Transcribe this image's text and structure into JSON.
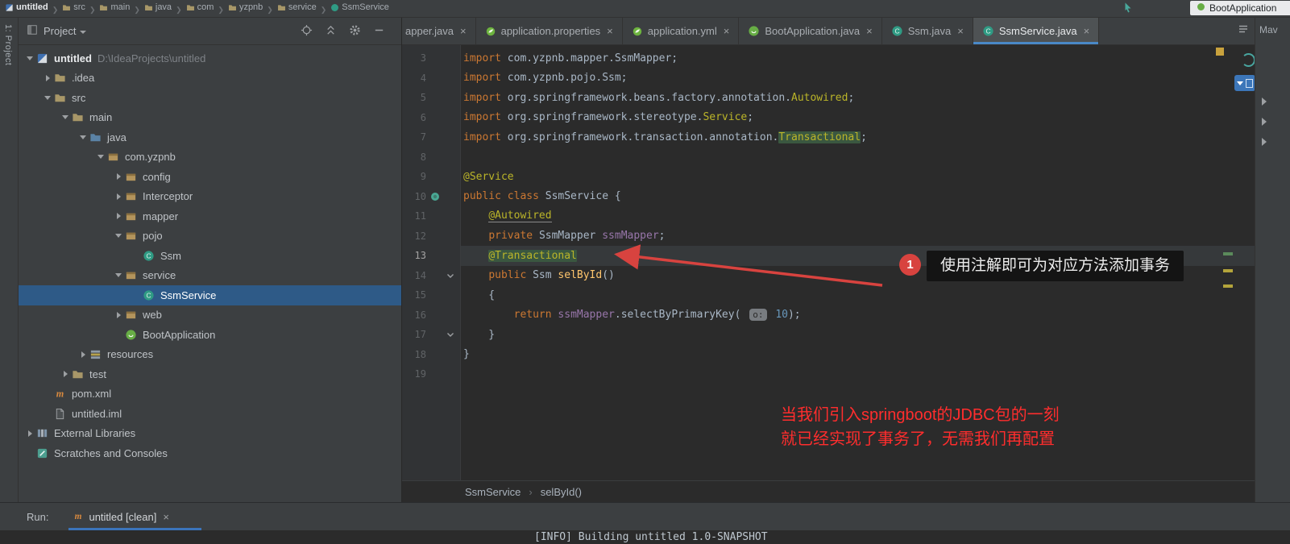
{
  "ui": {
    "crumb_sep": "❯",
    "breadcrumb_sep": "›",
    "close_glyph": "×"
  },
  "colors": {
    "selection_blue": "#2E5A87",
    "active_tab_underline": "#4A88C7",
    "annotation_red": "#D8433F",
    "note_red": "#FF2D2D",
    "keyword_orange": "#CC7832",
    "annotation_yellow": "#BBB529",
    "identifier_highlight_green": "#3A5740"
  },
  "window": {
    "breadcrumbs": [
      "untitled",
      "src",
      "main",
      "java",
      "com",
      "yzpnb",
      "service",
      "SsmService"
    ],
    "run_config_label": "BootApplication"
  },
  "left_stripe": {
    "label": "1: Project"
  },
  "project_panel": {
    "title": "Project",
    "tree": [
      {
        "label": "untitled",
        "hint": "D:\\IdeaProjects\\untitled",
        "level": 0,
        "arrow": "down",
        "icon": "project",
        "bold": true
      },
      {
        "label": ".idea",
        "level": 1,
        "arrow": "right",
        "icon": "folder"
      },
      {
        "label": "src",
        "level": 1,
        "arrow": "down",
        "icon": "folder"
      },
      {
        "label": "main",
        "level": 2,
        "arrow": "down",
        "icon": "folder"
      },
      {
        "label": "java",
        "level": 3,
        "arrow": "down",
        "icon": "folder-src"
      },
      {
        "label": "com.yzpnb",
        "level": 4,
        "arrow": "down",
        "icon": "package"
      },
      {
        "label": "config",
        "level": 5,
        "arrow": "right",
        "icon": "package"
      },
      {
        "label": "Interceptor",
        "level": 5,
        "arrow": "right",
        "icon": "package"
      },
      {
        "label": "mapper",
        "level": 5,
        "arrow": "right",
        "icon": "package"
      },
      {
        "label": "pojo",
        "level": 5,
        "arrow": "down",
        "icon": "package"
      },
      {
        "label": "Ssm",
        "level": 6,
        "arrow": null,
        "icon": "class"
      },
      {
        "label": "service",
        "level": 5,
        "arrow": "down",
        "icon": "package"
      },
      {
        "label": "SsmService",
        "level": 6,
        "arrow": null,
        "icon": "class",
        "selected": true
      },
      {
        "label": "web",
        "level": 5,
        "arrow": "right",
        "icon": "package"
      },
      {
        "label": "BootApplication",
        "level": 5,
        "arrow": null,
        "icon": "boot"
      },
      {
        "label": "resources",
        "level": 3,
        "arrow": "right",
        "icon": "resources"
      },
      {
        "label": "test",
        "level": 2,
        "arrow": "right",
        "icon": "folder"
      },
      {
        "label": "pom.xml",
        "level": 1,
        "arrow": null,
        "icon": "maven"
      },
      {
        "label": "untitled.iml",
        "level": 1,
        "arrow": null,
        "icon": "file"
      },
      {
        "label": "External Libraries",
        "level": 0,
        "arrow": "right",
        "icon": "library"
      },
      {
        "label": "Scratches and Consoles",
        "level": 0,
        "arrow": null,
        "icon": "scratch"
      }
    ]
  },
  "editor_tabs": {
    "items": [
      {
        "label": "apper.java",
        "icon": "none"
      },
      {
        "label": "application.properties",
        "icon": "spring"
      },
      {
        "label": "application.yml",
        "icon": "spring"
      },
      {
        "label": "BootApplication.java",
        "icon": "boot"
      },
      {
        "label": "Ssm.java",
        "icon": "class"
      },
      {
        "label": "SsmService.java",
        "icon": "class",
        "active": true
      }
    ]
  },
  "right_stripe": {
    "maven_label": "Mav"
  },
  "editor": {
    "lines": [
      {
        "n": 3,
        "segs": [
          {
            "t": "import ",
            "c": "kw"
          },
          {
            "t": "com.yzpnb.mapper.SsmMapper;",
            "c": "pl"
          }
        ]
      },
      {
        "n": 4,
        "segs": [
          {
            "t": "import ",
            "c": "kw"
          },
          {
            "t": "com.yzpnb.pojo.Ssm;",
            "c": "pl"
          }
        ]
      },
      {
        "n": 5,
        "segs": [
          {
            "t": "import ",
            "c": "kw"
          },
          {
            "t": "org.springframework.beans.factory.annotation.",
            "c": "pl"
          },
          {
            "t": "Autowired",
            "c": "ann"
          },
          {
            "t": ";",
            "c": "pl"
          }
        ]
      },
      {
        "n": 6,
        "segs": [
          {
            "t": "import ",
            "c": "kw"
          },
          {
            "t": "org.springframework.stereotype.",
            "c": "pl"
          },
          {
            "t": "Service",
            "c": "ann"
          },
          {
            "t": ";",
            "c": "pl"
          }
        ]
      },
      {
        "n": 7,
        "segs": [
          {
            "t": "import ",
            "c": "kw"
          },
          {
            "t": "org.springframework.transaction.annotation.",
            "c": "pl"
          },
          {
            "t": "Transactional",
            "c": "ann hl"
          },
          {
            "t": ";",
            "c": "pl"
          }
        ]
      },
      {
        "n": 8,
        "segs": []
      },
      {
        "n": 9,
        "segs": [
          {
            "t": "@Service",
            "c": "ann"
          }
        ]
      },
      {
        "n": 10,
        "gutter_icon": "bean",
        "segs": [
          {
            "t": "public class ",
            "c": "kw"
          },
          {
            "t": "SsmService {",
            "c": "pl"
          }
        ]
      },
      {
        "n": 11,
        "segs": [
          {
            "t": "    ",
            "c": "pl"
          },
          {
            "t": "@Autowired",
            "c": "ann u"
          }
        ]
      },
      {
        "n": 12,
        "segs": [
          {
            "t": "    ",
            "c": "pl"
          },
          {
            "t": "private ",
            "c": "kw"
          },
          {
            "t": "SsmMapper ",
            "c": "pl"
          },
          {
            "t": "ssmMapper",
            "c": "fld"
          },
          {
            "t": ";",
            "c": "pl"
          }
        ]
      },
      {
        "n": 13,
        "current": true,
        "segs": [
          {
            "t": "    ",
            "c": "pl"
          },
          {
            "t": "@Transactional",
            "c": "ann hl"
          }
        ]
      },
      {
        "n": 14,
        "fold": true,
        "segs": [
          {
            "t": "    ",
            "c": "pl"
          },
          {
            "t": "public ",
            "c": "kw"
          },
          {
            "t": "Ssm ",
            "c": "pl"
          },
          {
            "t": "selById",
            "c": "mth"
          },
          {
            "t": "()",
            "c": "pl"
          }
        ]
      },
      {
        "n": 15,
        "segs": [
          {
            "t": "    {",
            "c": "pl"
          }
        ]
      },
      {
        "n": 16,
        "segs": [
          {
            "t": "        ",
            "c": "pl"
          },
          {
            "t": "return ",
            "c": "kw"
          },
          {
            "t": "ssmMapper",
            "c": "fld"
          },
          {
            "t": ".selectByPrimaryKey( ",
            "c": "pl"
          },
          {
            "t": "o:",
            "c": "inlay"
          },
          {
            "t": " ",
            "c": "pl"
          },
          {
            "t": "10",
            "c": "num"
          },
          {
            "t": ");",
            "c": "pl"
          }
        ]
      },
      {
        "n": 17,
        "fold": true,
        "segs": [
          {
            "t": "    }",
            "c": "pl"
          }
        ]
      },
      {
        "n": 18,
        "segs": [
          {
            "t": "}",
            "c": "pl"
          }
        ]
      },
      {
        "n": 19,
        "segs": []
      }
    ]
  },
  "annotations": {
    "badge": "1",
    "tooltip": "使用注解即可为对应方法添加事务",
    "note": [
      "当我们引入springboot的JDBC包的一刻",
      "就已经实现了事务了，无需我们再配置"
    ]
  },
  "breadcrumb_bar": {
    "items": [
      "SsmService",
      "selById()"
    ]
  },
  "run_panel": {
    "label": "Run:",
    "tab_label": "untitled [clean]",
    "console_line": "[INFO] Building untitled 1.0-SNAPSHOT"
  }
}
